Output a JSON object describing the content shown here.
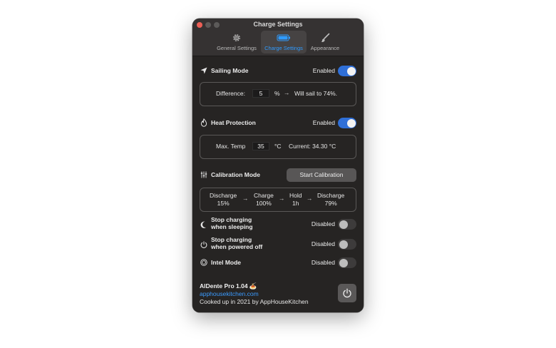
{
  "window": {
    "title": "Charge Settings"
  },
  "tabs": [
    {
      "label": "General Settings",
      "icon": "gear-icon"
    },
    {
      "label": "Charge Settings",
      "icon": "battery-icon",
      "active": true
    },
    {
      "label": "Appearance",
      "icon": "paintbrush-icon"
    }
  ],
  "sailing": {
    "label": "Sailing Mode",
    "state": "Enabled",
    "enabled": true,
    "difference_label": "Difference:",
    "difference_value": "5",
    "unit": "%",
    "result": "Will sail to 74%."
  },
  "heat": {
    "label": "Heat Protection",
    "state": "Enabled",
    "enabled": true,
    "max_label": "Max. Temp",
    "max_value": "35",
    "unit": "°C",
    "current": "Current: 34.30 °C"
  },
  "calibration": {
    "label": "Calibration Mode",
    "button": "Start Calibration",
    "steps": [
      {
        "line1": "Discharge",
        "line2": "15%"
      },
      {
        "line1": "Charge",
        "line2": "100%"
      },
      {
        "line1": "Hold",
        "line2": "1h"
      },
      {
        "line1": "Discharge",
        "line2": "79%"
      }
    ]
  },
  "options": [
    {
      "line1": "Stop charging",
      "line2": "when sleeping",
      "state": "Disabled",
      "enabled": false,
      "icon": "moon-icon"
    },
    {
      "line1": "Stop charging",
      "line2": "when powered off",
      "state": "Disabled",
      "enabled": false,
      "icon": "power-icon"
    },
    {
      "line1": "Intel Mode",
      "line2": "",
      "state": "Disabled",
      "enabled": false,
      "icon": "chip-icon"
    }
  ],
  "footer": {
    "app_name": "AlDente Pro 1.04 🍝",
    "link": "apphousekitchen.com",
    "credit": "Cooked up in 2021 by AppHouseKitchen"
  },
  "colors": {
    "accent": "#2f9bff",
    "toggle_on": "#2f6fd7",
    "window_bg": "#262423"
  }
}
